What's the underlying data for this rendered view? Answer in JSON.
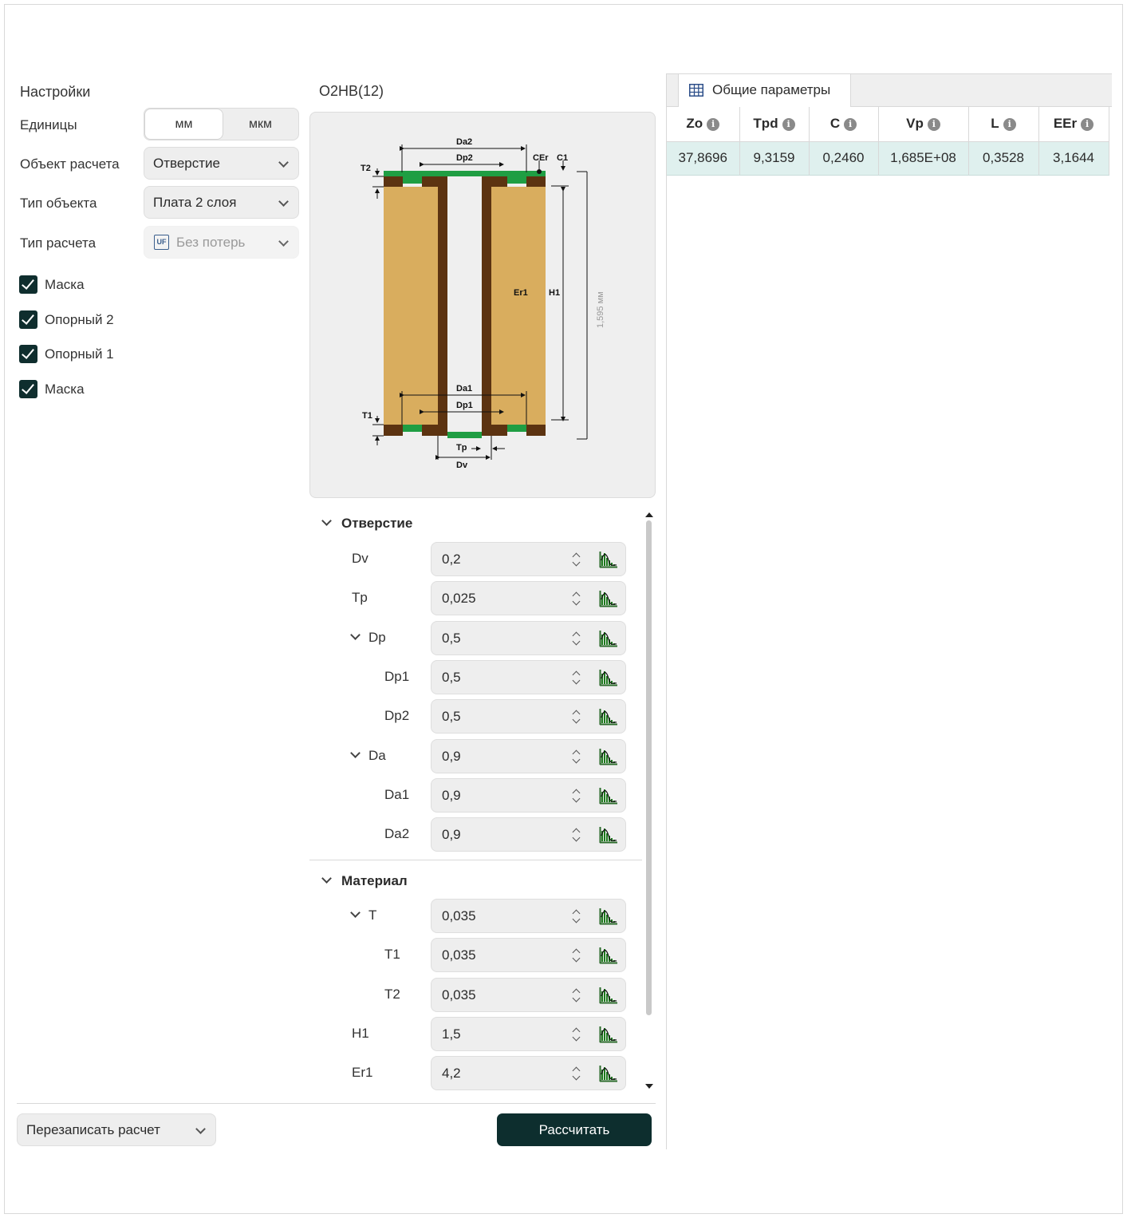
{
  "settings": {
    "title": "Настройки",
    "units_label": "Единицы",
    "units_options": [
      "мм",
      "мкм"
    ],
    "object_label": "Объект расчета",
    "object_value": "Отверстие",
    "object_type_label": "Тип объекта",
    "object_type_value": "Плата 2 слоя",
    "calc_type_label": "Тип расчета",
    "calc_type_value": "Без потерь",
    "calc_type_icon": "UF",
    "layers": [
      {
        "label": "Маска",
        "checked": true
      },
      {
        "label": "Опорный 2",
        "checked": true
      },
      {
        "label": "Опорный 1",
        "checked": true
      },
      {
        "label": "Маска",
        "checked": true
      }
    ]
  },
  "diagram": {
    "title": "O2HB(12)",
    "labels": {
      "da2": "Da2",
      "dp2": "Dp2",
      "cer": "CEr",
      "c1": "C1",
      "t2": "T2",
      "er1": "Er1",
      "h1": "H1",
      "thickness": "1,595 мм",
      "da1": "Da1",
      "dp1": "Dp1",
      "t1": "T1",
      "tp": "Tp",
      "dv": "Dv"
    },
    "colors": {
      "dielectric": "#d9ad5e",
      "copper": "#5c3311",
      "mask": "#1f9e43"
    }
  },
  "params": {
    "hole_section": "Отверстие",
    "material_section": "Материал",
    "hole_rows": [
      {
        "label": "Dv",
        "value": "0,2"
      },
      {
        "label": "Tp",
        "value": "0,025"
      },
      {
        "label": "Dp",
        "value": "0,5"
      },
      {
        "label": "Dp1",
        "value": "0,5"
      },
      {
        "label": "Dp2",
        "value": "0,5"
      },
      {
        "label": "Da",
        "value": "0,9"
      },
      {
        "label": "Da1",
        "value": "0,9"
      },
      {
        "label": "Da2",
        "value": "0,9"
      }
    ],
    "material_rows": [
      {
        "label": "T",
        "value": "0,035"
      },
      {
        "label": "T1",
        "value": "0,035"
      },
      {
        "label": "T2",
        "value": "0,035"
      },
      {
        "label": "H1",
        "value": "1,5"
      },
      {
        "label": "Er1",
        "value": "4,2"
      }
    ]
  },
  "footer": {
    "mode_value": "Перезаписать расчет",
    "calculate_label": "Рассчитать"
  },
  "results": {
    "tab_label": "Общие параметры",
    "columns": [
      "Zo",
      "Tpd",
      "C",
      "Vp",
      "L",
      "EEr"
    ],
    "row": [
      "37,8696",
      "9,3159",
      "0,2460",
      "1,685E+08",
      "0,3528",
      "3,1644"
    ],
    "accent_row_bg": "#dff0ee"
  }
}
